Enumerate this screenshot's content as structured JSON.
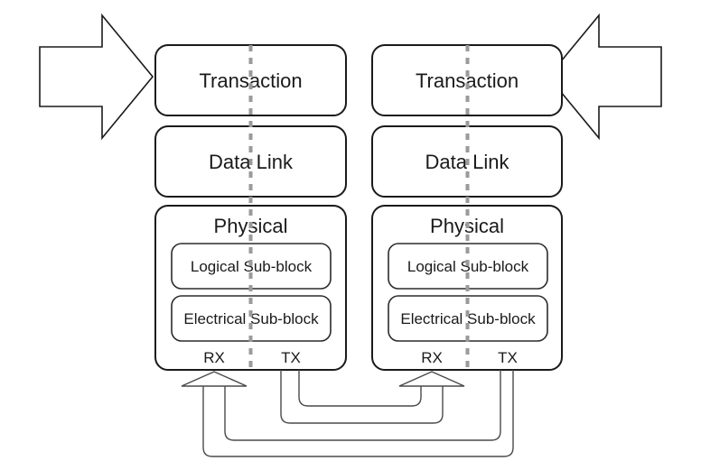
{
  "diagram": {
    "title": "PCI Express layered architecture with two devices",
    "colors": {
      "background": "#ffffff",
      "box_stroke": "#1a1a1a",
      "sub_stroke": "#2b2b2b",
      "divider": "#9a9a9a",
      "link_stroke": "#4a4a4a",
      "text": "#1a1a1a"
    },
    "left_arrow": {
      "name": "inbound-flow-arrow",
      "direction": "right"
    },
    "right_arrow": {
      "name": "outbound-flow-arrow",
      "direction": "left"
    },
    "devices": [
      {
        "id": "left-device",
        "layers": [
          {
            "id": "transaction",
            "label": "Transaction"
          },
          {
            "id": "data-link",
            "label": "Data Link"
          },
          {
            "id": "physical",
            "label": "Physical"
          }
        ],
        "sub_blocks": [
          {
            "id": "logical-sub-block",
            "label": "Logical Sub-block"
          },
          {
            "id": "electrical-sub-block",
            "label": "Electrical Sub-block"
          }
        ],
        "ports": [
          {
            "id": "rx",
            "label": "RX"
          },
          {
            "id": "tx",
            "label": "TX"
          }
        ]
      },
      {
        "id": "right-device",
        "layers": [
          {
            "id": "transaction",
            "label": "Transaction"
          },
          {
            "id": "data-link",
            "label": "Data Link"
          },
          {
            "id": "physical",
            "label": "Physical"
          }
        ],
        "sub_blocks": [
          {
            "id": "logical-sub-block",
            "label": "Logical Sub-block"
          },
          {
            "id": "electrical-sub-block",
            "label": "Electrical Sub-block"
          }
        ],
        "ports": [
          {
            "id": "rx",
            "label": "RX"
          },
          {
            "id": "tx",
            "label": "TX"
          }
        ]
      }
    ],
    "links": [
      {
        "id": "left-tx-to-right-rx",
        "from": "left-device.tx",
        "to": "right-device.rx"
      },
      {
        "id": "right-tx-to-left-rx",
        "from": "right-device.tx",
        "to": "left-device.rx"
      }
    ]
  }
}
